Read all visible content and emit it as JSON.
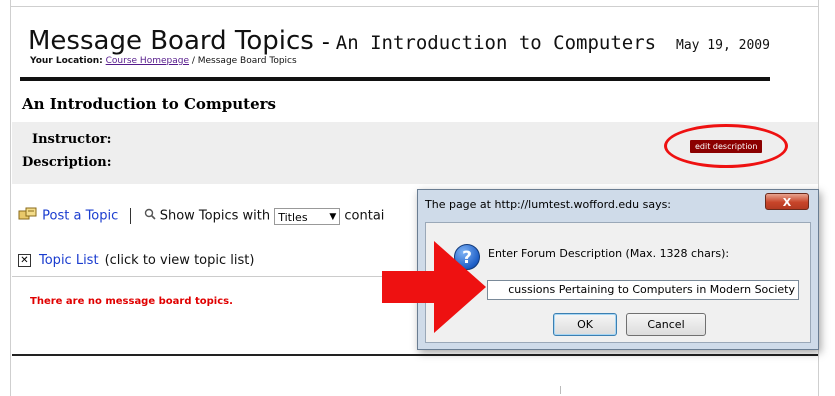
{
  "header": {
    "title": "Message Board Topics",
    "separator": "-",
    "course": "An Introduction to Computers",
    "date": "May 19, 2009",
    "location_label": "Your Location:",
    "location_link": "Course Homepage",
    "location_rest": "/ Message Board Topics"
  },
  "section": {
    "title": "An Introduction to Computers",
    "instructor_label": "Instructor:",
    "description_label": "Description:",
    "edit_button": "edit description"
  },
  "toolbar": {
    "post_topic": "Post a Topic",
    "show_topics": "Show Topics with",
    "select_value": "Titles",
    "contains": "contai"
  },
  "topic_list": {
    "label": "Topic List",
    "hint": "(click to view topic list)",
    "empty_message": "There are no message board topics."
  },
  "dialog": {
    "title": "The page at http://lumtest.wofford.edu says:",
    "close": "X",
    "prompt": "Enter Forum Description (Max. 1328 chars):",
    "input_value": "cussions Pertaining to Computers in Modern Society",
    "ok": "OK",
    "cancel": "Cancel"
  },
  "colors": {
    "edit_button_bg": "#8b0000",
    "annotation_red": "#ee1111",
    "link": "#1a3ccf",
    "empty_message": "#e00000"
  },
  "icons": [
    "post-topic-icon",
    "magnifier-icon",
    "collapse-x-icon",
    "question-icon",
    "close-icon",
    "annotation-arrow"
  ]
}
